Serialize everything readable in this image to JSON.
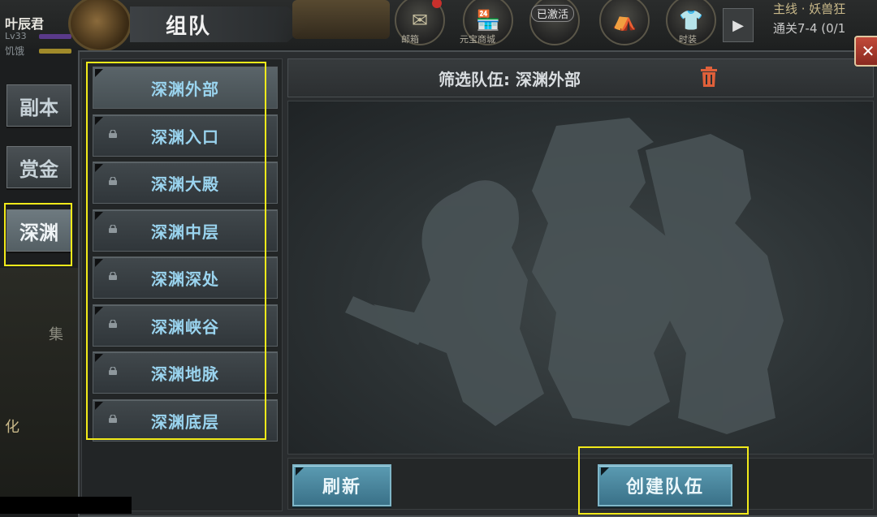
{
  "player": {
    "name": "叶辰君",
    "level": "Lv33",
    "hunger_label": "饥饿"
  },
  "window": {
    "title": "组队"
  },
  "top_icons": [
    {
      "icon": "mail-icon",
      "label": "邮箱"
    },
    {
      "icon": "shop-icon",
      "label": "元宝商城"
    },
    {
      "icon": "activated-icon",
      "label": "已激活"
    },
    {
      "icon": "tent-icon",
      "label": ""
    },
    {
      "icon": "outfit-icon",
      "label": "时装"
    }
  ],
  "top_badge": "已激活",
  "quest": {
    "title": "主线 · 妖兽狂",
    "progress": "通关7-4 (0/1"
  },
  "side_tabs": [
    {
      "label": "副本",
      "active": false
    },
    {
      "label": "赏金",
      "active": false
    },
    {
      "label": "深渊",
      "active": true
    }
  ],
  "dungeons": [
    {
      "label": "深渊外部",
      "locked": false,
      "selected": true
    },
    {
      "label": "深渊入口",
      "locked": true,
      "selected": false
    },
    {
      "label": "深渊大殿",
      "locked": true,
      "selected": false
    },
    {
      "label": "深渊中层",
      "locked": true,
      "selected": false
    },
    {
      "label": "深渊深处",
      "locked": true,
      "selected": false
    },
    {
      "label": "深渊峡谷",
      "locked": true,
      "selected": false
    },
    {
      "label": "深渊地脉",
      "locked": true,
      "selected": false
    },
    {
      "label": "深渊底层",
      "locked": true,
      "selected": false
    }
  ],
  "filter": {
    "text": "筛选队伍: 深渊外部"
  },
  "buttons": {
    "refresh": "刷新",
    "create_team": "创建队伍"
  },
  "bg_glyphs": {
    "a": "集",
    "b": "化"
  },
  "colors": {
    "accent_button": "#4a86a0",
    "dungeon_text": "#9ad4ef",
    "highlight": "#f2ea1a",
    "trash": "#e0603a"
  }
}
